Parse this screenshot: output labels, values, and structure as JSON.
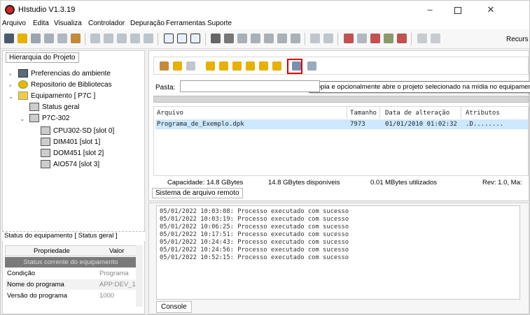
{
  "window": {
    "title": "HIstudio V1.3.19",
    "minimize": "–",
    "close": "✕"
  },
  "menu": [
    "Arquivo",
    "Edita",
    "Visualiza",
    "Controlador",
    "Depuração",
    "Ferramentas",
    "Suporte"
  ],
  "toolbar": {
    "recursos_label": "Recurs"
  },
  "project_panel": {
    "tab": "Hierarquia do Projeto",
    "tree": [
      {
        "label": "Preferencias do ambiente",
        "icon": "computer-icon"
      },
      {
        "label": "Repositorio de Bibliotecas",
        "icon": "gear-icon"
      },
      {
        "label": "Equipamento [ P7C ]",
        "icon": "device-icon"
      },
      {
        "label": "Status geral",
        "icon": "status-icon"
      },
      {
        "label": "P7C-302",
        "icon": "controller-icon"
      },
      {
        "label": "CPU302-SD [slot 0]",
        "icon": "module-icon"
      },
      {
        "label": "DIM401 [slot 1]",
        "icon": "module-icon"
      },
      {
        "label": "DOM451 [slot 2]",
        "icon": "module-icon"
      },
      {
        "label": "AIO574 [slot 3]",
        "icon": "module-icon"
      }
    ]
  },
  "status_panel": {
    "title": "Status do equipamento [ Status geral ]",
    "columns": [
      "Propriedade",
      "Valor"
    ],
    "group": "Status corrente do equipamento",
    "rows": [
      {
        "key": "Condição",
        "value": "Programa"
      },
      {
        "key": "Nome do programa",
        "value": "APP:DEV_1"
      },
      {
        "key": "Versão do programa",
        "value": "1000"
      }
    ]
  },
  "file_panel": {
    "tooltip": "Copia e opcionalmente abre o projeto selecionado na mídia no equipamento",
    "pasta_label": "Pasta:",
    "pasta_value": "",
    "columns": [
      "Arquivo",
      "Tamanho",
      "Data de alteração",
      "Atributos"
    ],
    "files": [
      {
        "name": "Programa_de_Exemplo.dpk",
        "size": "7973",
        "date": "01/01/2010 01:02:32",
        "attrs": ".D........"
      }
    ],
    "capacity": "Capacidade: 14.8 GBytes",
    "available": "14.8 GBytes disponíveis",
    "used": "0.01 MBytes utilizados",
    "rev": "Rev: 1.0, Ma:",
    "tab": "Sistema de arquivo remoto"
  },
  "console": {
    "tab": "Console",
    "lines": [
      "05/01/2022 10:03:08: Processo executado com sucesso",
      "05/01/2022 10:03:19: Processo executado com sucesso",
      "05/01/2022 10:06:25: Processo executado com sucesso",
      "05/01/2022 10:17:51: Processo executado com sucesso",
      "05/01/2022 10:24:43: Processo executado com sucesso",
      "05/01/2022 10:24:56: Processo executado com sucesso",
      "05/01/2022 10:52:15: Processo executado com sucesso"
    ]
  },
  "colors": {
    "highlight_frame": "#e00000",
    "selected_row": "#cde8ff",
    "group_row": "#7a7a7a"
  }
}
